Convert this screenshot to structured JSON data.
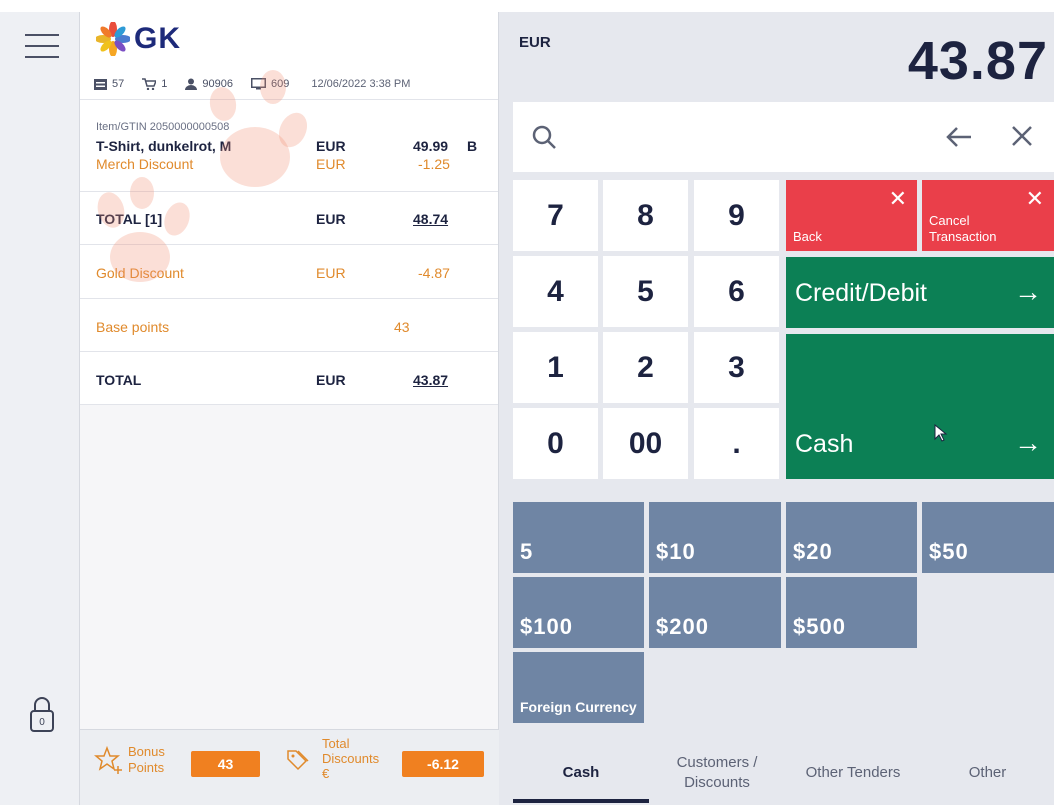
{
  "header": {
    "logo_text": "GK",
    "status": {
      "receipts": "57",
      "cart": "1",
      "user": "90906",
      "terminal": "609",
      "datetime": "12/06/2022 3:38 PM"
    }
  },
  "receipt": {
    "item": {
      "gtin": "Item/GTIN 2050000000508",
      "name": "T-Shirt, dunkelrot, M",
      "currency": "EUR",
      "price": "49.99",
      "tax_code": "B",
      "discount_name": "Merch Discount",
      "discount_currency": "EUR",
      "discount_value": "-1.25"
    },
    "subtotal": {
      "label": "TOTAL [1]",
      "currency": "EUR",
      "value": "48.74"
    },
    "gold": {
      "label": "Gold Discount",
      "currency": "EUR",
      "value": "-4.87"
    },
    "points": {
      "label": "Base points",
      "value": "43"
    },
    "total": {
      "label": "TOTAL",
      "currency": "EUR",
      "value": "43.87"
    }
  },
  "footer": {
    "bonus_label_1": "Bonus",
    "bonus_label_2": "Points",
    "bonus_value": "43",
    "disc_label_1": "Total",
    "disc_label_2": "Discounts",
    "disc_label_3": "€",
    "disc_value": "-6.12"
  },
  "display": {
    "currency": "EUR",
    "amount": "43.87"
  },
  "keypad": {
    "k7": "7",
    "k8": "8",
    "k9": "9",
    "k4": "4",
    "k5": "5",
    "k6": "6",
    "k1": "1",
    "k2": "2",
    "k3": "3",
    "k0": "0",
    "k00": "00",
    "kdot": "."
  },
  "actions": {
    "back": "Back",
    "cancel_1": "Cancel",
    "cancel_2": "Transaction",
    "credit": "Credit/Debit",
    "cash": "Cash"
  },
  "tenders": {
    "t5": "5",
    "t10": "$10",
    "t20": "$20",
    "t50": "$50",
    "t100": "$100",
    "t200": "$200",
    "t500": "$500",
    "foreign": "Foreign Currency"
  },
  "tabs": {
    "cash": "Cash",
    "customers_1": "Customers /",
    "customers_2": "Discounts",
    "other_tenders": "Other Tenders",
    "other": "Other"
  },
  "colors": {
    "accent_orange": "#e08a2c",
    "badge_orange": "#f08020",
    "cancel_red": "#ea3f4a",
    "payment_green": "#0c8055",
    "tender_blue": "#6f85a4",
    "navy": "#1d2340"
  }
}
